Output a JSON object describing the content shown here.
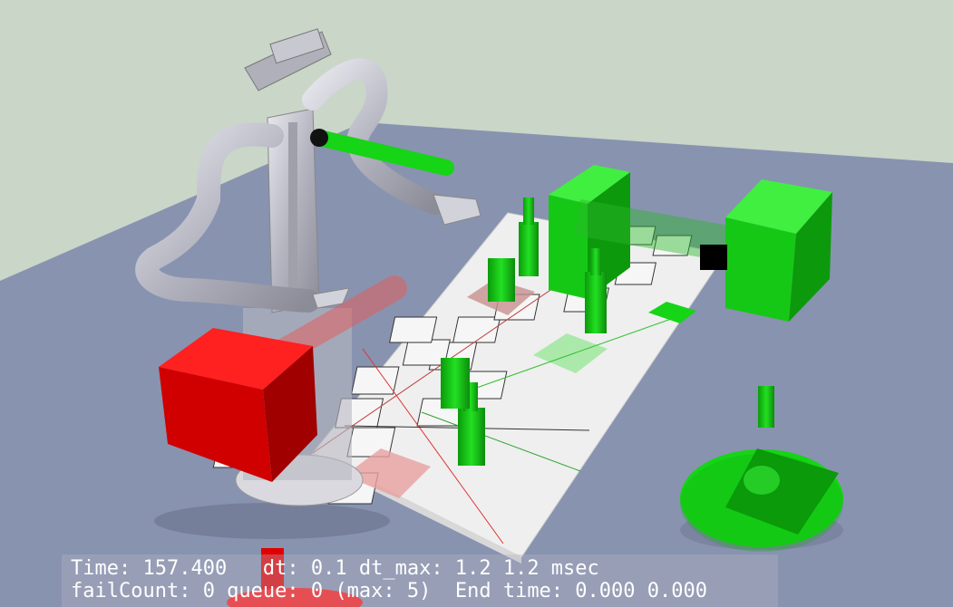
{
  "viewer": {
    "hud_line1": "Time: 157.400   dt: 0.1 dt_max: 1.2 1.2 msec",
    "hud_line2": "failCount: 0 queue: 0 (max: 5)  End time: 0.000 0.000"
  },
  "colors": {
    "sky": "#c9d6c8",
    "floor": "#8893b0",
    "table": "#efefef",
    "object_green": "#16d416",
    "object_red": "#e50000",
    "robot_silver": "#c8c8d2"
  },
  "scene_objects": [
    "mobile-manipulator-robot",
    "red-cube",
    "green-box-large",
    "green-box-right",
    "green-cylinder-peg",
    "green-disc-platform",
    "grid-table"
  ]
}
